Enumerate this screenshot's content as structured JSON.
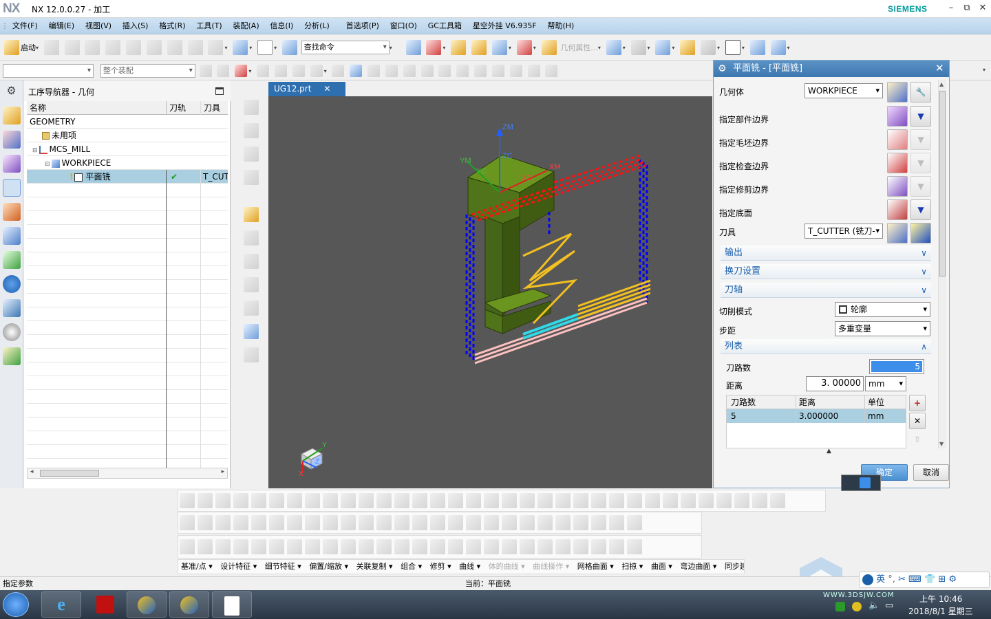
{
  "window": {
    "logo": "NX",
    "title": "NX 12.0.0.27 - 加工",
    "brand": "SIEMENS",
    "minimize": "–",
    "restore": "⧉",
    "close": "✕"
  },
  "menu": [
    "文件(F)",
    "编辑(E)",
    "视图(V)",
    "插入(S)",
    "格式(R)",
    "工具(T)",
    "装配(A)",
    "信息(I)",
    "分析(L)",
    "首选项(P)",
    "窗口(O)",
    "GC工具箱",
    "星空外挂 V6.935F",
    "帮助(H)"
  ],
  "toolbar1": {
    "start_label": "启动",
    "search_placeholder": "查找命令",
    "geometry_props": "几何属性..."
  },
  "toolbar2": {
    "filter_value": "",
    "assembly_value": "整个装配"
  },
  "navigator": {
    "title": "工序导航器 - 几何",
    "columns": [
      "名称",
      "刀轨",
      "刀具"
    ],
    "rows": [
      {
        "name": "GEOMETRY",
        "path": "",
        "tool": ""
      },
      {
        "name": "未用项",
        "path": "",
        "tool": ""
      },
      {
        "name": "MCS_MILL",
        "path": "",
        "tool": ""
      },
      {
        "name": "WORKPIECE",
        "path": "",
        "tool": ""
      },
      {
        "name": "平面铣",
        "path": "✔",
        "tool": "T_CUT"
      }
    ]
  },
  "graphics": {
    "tab": "UG12.prt",
    "axes": {
      "zm": "ZM",
      "zc": "ZC",
      "ym": "YM",
      "xc": "XC",
      "xm": "XM",
      "yc": "YC"
    },
    "triad": {
      "y": "Y",
      "x": "X",
      "z": "Z"
    }
  },
  "dialog": {
    "title": "平面铣 - [平面铣]",
    "geometry_label": "几何体",
    "geometry_value": "WORKPIECE",
    "part_boundary": "指定部件边界",
    "blank_boundary": "指定毛坯边界",
    "check_boundary": "指定检查边界",
    "trim_boundary": "指定修剪边界",
    "floor": "指定底面",
    "tool_label": "刀具",
    "tool_value": "T_CUTTER (铣刀-",
    "sections": [
      "输出",
      "换刀设置",
      "刀轴"
    ],
    "cut_pattern_label": "切削模式",
    "cut_pattern_value": "轮廓",
    "stepover_label": "步距",
    "stepover_value": "多重变量",
    "list_section": "列表",
    "passes_label": "刀路数",
    "passes_value": "5",
    "distance_label": "距离",
    "distance_value": "3. 00000",
    "distance_unit": "mm",
    "table_headers": [
      "刀路数",
      "距离",
      "单位"
    ],
    "table_row": {
      "passes": "5",
      "distance": "3.000000",
      "unit": "mm"
    },
    "ok": "确定",
    "cancel": "取消"
  },
  "bottom_menu": [
    "基准/点",
    "设计特征",
    "细节特征",
    "偏置/缩放",
    "关联复制",
    "组合",
    "修剪",
    "曲线",
    "体的曲线",
    "曲线操作",
    "网格曲面",
    "扫掠",
    "曲面",
    "弯边曲面",
    "同步建模"
  ],
  "status": {
    "left": "指定参数",
    "center": "当前：平面铣"
  },
  "tray": {
    "lang": "英",
    "time": "上午 10:46",
    "date": "2018/8/1 星期三",
    "watermark": "WWW.3DSJW.COM"
  },
  "colors": {
    "accent": "#3c77b0",
    "model": "#5a7d1a",
    "boundary_blue": "#0000ff",
    "boundary_red": "#ff0000",
    "toolpath": "#f2c020"
  }
}
